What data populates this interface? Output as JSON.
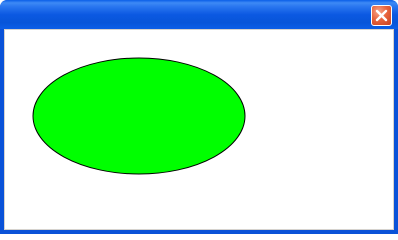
{
  "window": {
    "title": ""
  },
  "titlebar": {
    "close_icon": "close-icon"
  },
  "canvas": {
    "shape": "ellipse",
    "fill_color": "#00ff00",
    "stroke_color": "#000000"
  }
}
